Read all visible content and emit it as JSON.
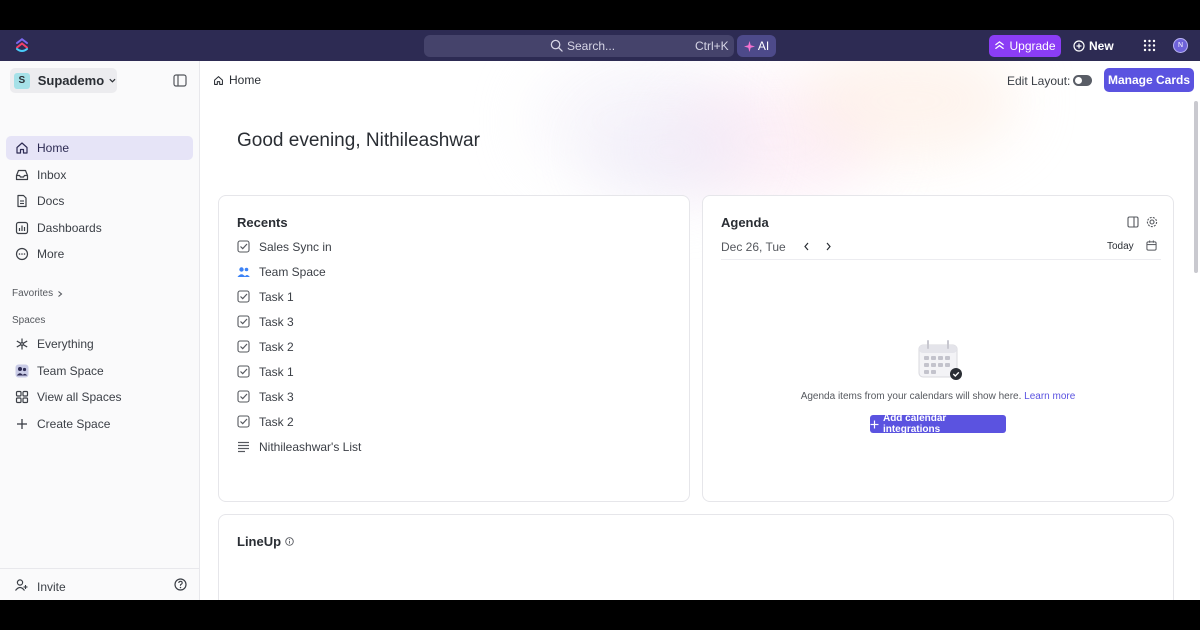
{
  "topbar": {
    "search_placeholder": "Search...",
    "search_shortcut": "Ctrl+K",
    "ai_label": "AI",
    "upgrade_label": "Upgrade",
    "new_label": "New",
    "avatar_initial": "N"
  },
  "sidebar": {
    "workspace_initial": "S",
    "workspace_name": "Supademo",
    "nav": [
      {
        "label": "Home",
        "icon": "home-icon",
        "active": true
      },
      {
        "label": "Inbox",
        "icon": "inbox-icon"
      },
      {
        "label": "Docs",
        "icon": "docs-icon"
      },
      {
        "label": "Dashboards",
        "icon": "dashboards-icon"
      },
      {
        "label": "More",
        "icon": "more-icon"
      }
    ],
    "favorites_label": "Favorites",
    "spaces_label": "Spaces",
    "spaces": [
      {
        "label": "Everything",
        "icon": "everything-icon"
      },
      {
        "label": "Team Space",
        "icon": "team-icon"
      },
      {
        "label": "View all Spaces",
        "icon": "grid-icon"
      },
      {
        "label": "Create Space",
        "icon": "plus-icon"
      }
    ],
    "invite_label": "Invite"
  },
  "main": {
    "breadcrumb": "Home",
    "edit_layout_label": "Edit Layout:",
    "manage_cards_label": "Manage Cards",
    "greeting": "Good evening, Nithileashwar"
  },
  "recents": {
    "title": "Recents",
    "items": [
      {
        "label": "Sales Sync in",
        "icon": "task-check-icon"
      },
      {
        "label": "Team Space",
        "icon": "team-icon"
      },
      {
        "label": "Task 1",
        "icon": "task-check-icon"
      },
      {
        "label": "Task 3",
        "icon": "task-check-icon"
      },
      {
        "label": "Task 2",
        "icon": "task-check-icon"
      },
      {
        "label": "Task 1",
        "icon": "task-check-icon"
      },
      {
        "label": "Task 3",
        "icon": "task-check-icon"
      },
      {
        "label": "Task 2",
        "icon": "task-check-icon"
      },
      {
        "label": "Nithileashwar's List",
        "icon": "list-icon"
      }
    ]
  },
  "agenda": {
    "title": "Agenda",
    "date": "Dec 26, Tue",
    "today_label": "Today",
    "empty_text": "Agenda items from your calendars will show here.",
    "learn_more": "Learn more",
    "add_integrations_label": "Add calendar integrations"
  },
  "lineup": {
    "title": "LineUp"
  },
  "colors": {
    "topbar_bg": "#2d2b53",
    "accent": "#5b53e0",
    "upgrade": "#8b3df5",
    "active_nav": "#e6e4f7"
  }
}
